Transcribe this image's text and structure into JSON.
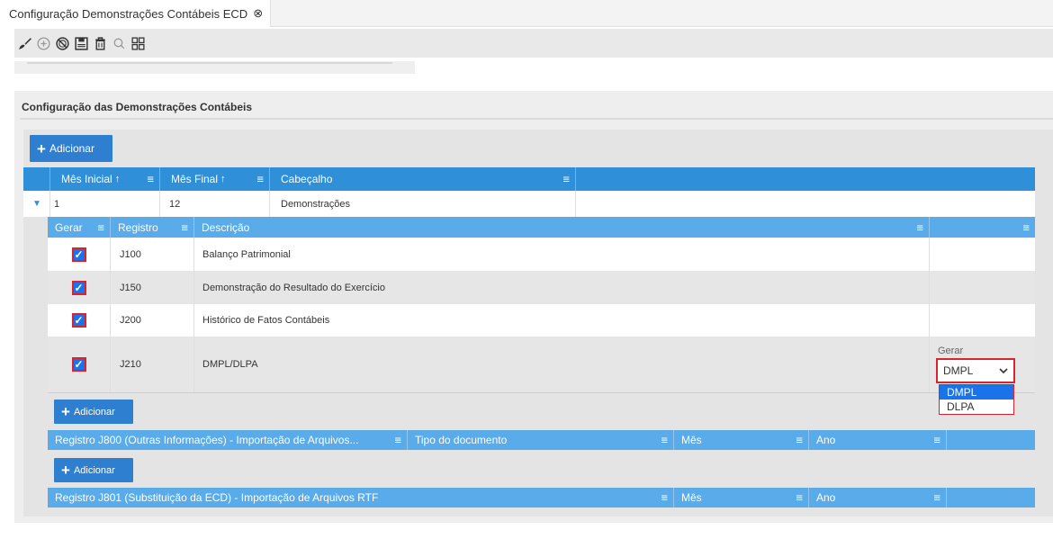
{
  "tab": {
    "title": "Configuração Demonstrações Contábeis ECD",
    "close": "⊗"
  },
  "toolbar": {
    "icons": [
      "brush-icon",
      "add-icon",
      "cancel-icon",
      "save-icon",
      "trash-icon",
      "search-icon",
      "grid-icon"
    ]
  },
  "panel": {
    "title": "Configuração das Demonstrações Contábeis"
  },
  "main_grid": {
    "add_label": "Adicionar",
    "columns": [
      "Mês Inicial",
      "Mês Final",
      "Cabeçalho"
    ],
    "sort_glyph": "↑",
    "menu_glyph": "≡",
    "expand_glyph": "▼",
    "row": {
      "mes_inicial": "1",
      "mes_final": "12",
      "cabecalho": "Demonstrações"
    }
  },
  "detail_grid": {
    "columns": [
      "Gerar",
      "Registro",
      "Descrição"
    ],
    "rows": [
      {
        "gerar": true,
        "registro": "J100",
        "descricao": "Balanço Patrimonial"
      },
      {
        "gerar": true,
        "registro": "J150",
        "descricao": "Demonstração do Resultado do Exercício"
      },
      {
        "gerar": true,
        "registro": "J200",
        "descricao": "Histórico de Fatos Contábeis"
      },
      {
        "gerar": true,
        "registro": "J210",
        "descricao": "DMPL/DLPA"
      }
    ],
    "check_glyph": "✓",
    "gerar_field": {
      "label": "Gerar",
      "value": "DMPL",
      "options": [
        "DMPL",
        "DLPA"
      ]
    },
    "add_label": "Adicionar"
  },
  "j800_grid": {
    "columns": [
      "Registro J800 (Outras Informações) - Importação de Arquivos...",
      "Tipo do documento",
      "Mês",
      "Ano"
    ],
    "add_label": "Adicionar"
  },
  "j801_grid": {
    "columns": [
      "Registro J801 (Substituição da ECD) - Importação de Arquivos RTF",
      "Mês",
      "Ano"
    ]
  },
  "colors": {
    "header_blue": "#2f8fd9",
    "subheader_blue": "#5aabea",
    "button_blue": "#2f7fd1",
    "highlight_red": "#d9232e"
  }
}
